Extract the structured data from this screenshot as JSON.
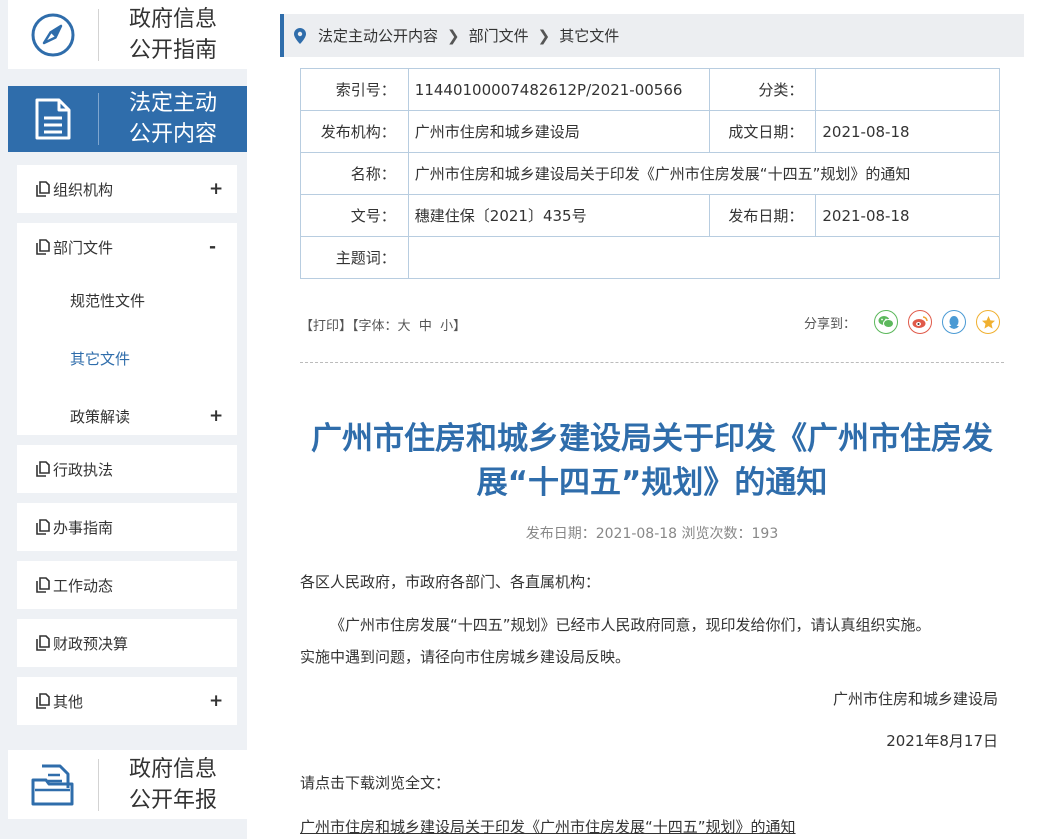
{
  "sidebar": {
    "guide": {
      "line1": "政府信息",
      "line2": "公开指南"
    },
    "active_section": {
      "line1": "法定主动",
      "line2": "公开内容"
    },
    "items": [
      {
        "label": "组织机构",
        "toggle": "+"
      },
      {
        "label": "部门文件",
        "toggle": "-",
        "children": [
          {
            "label": "规范性文件"
          },
          {
            "label": "其它文件",
            "current": true
          },
          {
            "label": "政策解读",
            "toggle": "+"
          }
        ]
      },
      {
        "label": "行政执法"
      },
      {
        "label": "办事指南"
      },
      {
        "label": "工作动态"
      },
      {
        "label": "财政预决算"
      },
      {
        "label": "其他",
        "toggle": "+"
      }
    ],
    "annual_report": {
      "line1": "政府信息",
      "line2": "公开年报"
    }
  },
  "breadcrumb": [
    "法定主动公开内容",
    "部门文件",
    "其它文件"
  ],
  "meta": {
    "index_label": "索引号：",
    "index_value": "11440100007482612P/2021-00566",
    "category_label": "分类：",
    "category_value": "",
    "publisher_label": "发布机构：",
    "publisher_value": "广州市住房和城乡建设局",
    "created_label": "成文日期：",
    "created_value": "2021-08-18",
    "name_label": "名称：",
    "name_value": "广州市住房和城乡建设局关于印发《广州市住房发展“十四五”规划》的通知",
    "docno_label": "文号：",
    "docno_value": "穗建住保〔2021〕435号",
    "published_label": "发布日期：",
    "published_value": "2021-08-18",
    "subject_label": "主题词：",
    "subject_value": ""
  },
  "tools": {
    "print": "【打印】",
    "font_prefix": "【字体：",
    "large": "大",
    "medium": "中",
    "small": "小",
    "font_suffix": "】"
  },
  "share": {
    "label": "分享到：",
    "icons": [
      "wechat-icon",
      "weibo-icon",
      "qq-icon",
      "qzone-icon"
    ]
  },
  "article": {
    "title_line1": "广州市住房和城乡建设局关于印发《广州市住房发",
    "title_line2": "展“十四五”规划》的通知",
    "pubinfo": "发布日期：2021-08-18  浏览次数：193",
    "salutation": "各区人民政府，市政府各部门、各直属机构：",
    "body": "《广州市住房发展“十四五”规划》已经市人民政府同意，现印发给你们，请认真组织实施。",
    "body2": "实施中遇到问题，请径向市住房城乡建设局反映。",
    "signature": "广州市住房和城乡建设局",
    "date": "2021年8月17日",
    "download_prompt": "请点击下载浏览全文：",
    "attachment": "广州市住房和城乡建设局关于印发《广州市住房发展“十四五”规划》的通知"
  },
  "colors": {
    "accent": "#2f6dab",
    "sidebar_bg": "#eef1f5",
    "table_border": "#b8cde0"
  }
}
